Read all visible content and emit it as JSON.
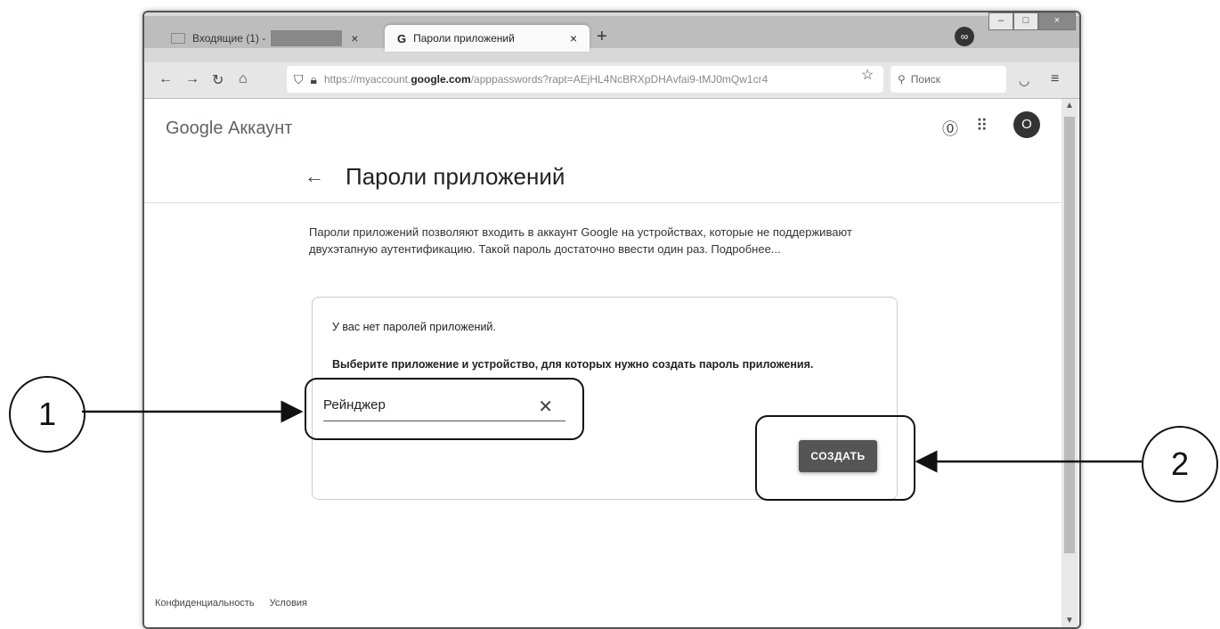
{
  "browser": {
    "tab1_label": "Входящие (1) -",
    "tab2_label": "Пароли приложений",
    "tab2_favicon": "G",
    "url_prefix": "https://myaccount.",
    "url_domain": "google.com",
    "url_suffix": "/apppasswords?rapt=AEjHL4NcBRXpDHAvfai9-tMJ0mQw1cr4",
    "search_placeholder": "Поиск",
    "newtab": "+",
    "close_tab": "×"
  },
  "header": {
    "brand": "Google Аккаунт",
    "avatar_letter": "O"
  },
  "page": {
    "title": "Пароли приложений",
    "description": "Пароли приложений позволяют входить в аккаунт Google на устройствах, которые не поддерживают двухэтапную аутентификацию. Такой пароль достаточно ввести один раз. Подробнее...",
    "empty_text": "У вас нет паролей приложений.",
    "instruction": "Выберите приложение и устройство, для которых нужно создать пароль приложения.",
    "app_name_value": "Рейнджер",
    "create_button": "СОЗДАТЬ"
  },
  "footer": {
    "privacy": "Конфиденциальность",
    "terms": "Условия"
  },
  "callouts": {
    "one": "1",
    "two": "2"
  },
  "icons": [
    "back-arrow-icon",
    "forward-arrow-icon",
    "reload-icon",
    "home-icon",
    "shield-icon",
    "lock-icon",
    "star-icon",
    "search-icon",
    "pocket-icon",
    "menu-icon",
    "help-icon",
    "apps-grid-icon",
    "clear-icon",
    "gmail-icon",
    "google-g-icon",
    "private-mask-icon"
  ]
}
